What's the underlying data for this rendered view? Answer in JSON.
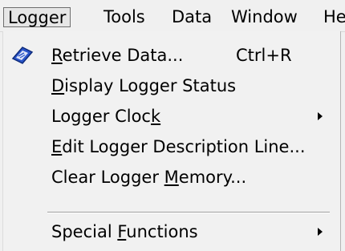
{
  "menubar": {
    "items": [
      {
        "label": "Logger",
        "active": true
      },
      {
        "label": "Tools",
        "active": false
      },
      {
        "label": "Data",
        "active": false
      },
      {
        "label": "Window",
        "active": false
      },
      {
        "label": "He",
        "active": false
      }
    ]
  },
  "menu": {
    "items": [
      {
        "pre": "",
        "mn": "R",
        "post": "etrieve Data...",
        "shortcut": "Ctrl+R",
        "icon": "retrieve-data-icon"
      },
      {
        "pre": "",
        "mn": "D",
        "post": "isplay Logger Status"
      },
      {
        "pre": "Logger Cloc",
        "mn": "k",
        "post": "",
        "submenu": true
      },
      {
        "pre": "",
        "mn": "E",
        "post": "dit Logger Description Line..."
      },
      {
        "pre": "Clear Logger ",
        "mn": "M",
        "post": "emory..."
      },
      {
        "pre": "Special ",
        "mn": "F",
        "post": "unctions",
        "submenu": true
      }
    ]
  },
  "colors": {
    "menu_background": "#f0f0f0",
    "active_border": "#6e6e6e",
    "icon_blue": "#2a55c9"
  }
}
